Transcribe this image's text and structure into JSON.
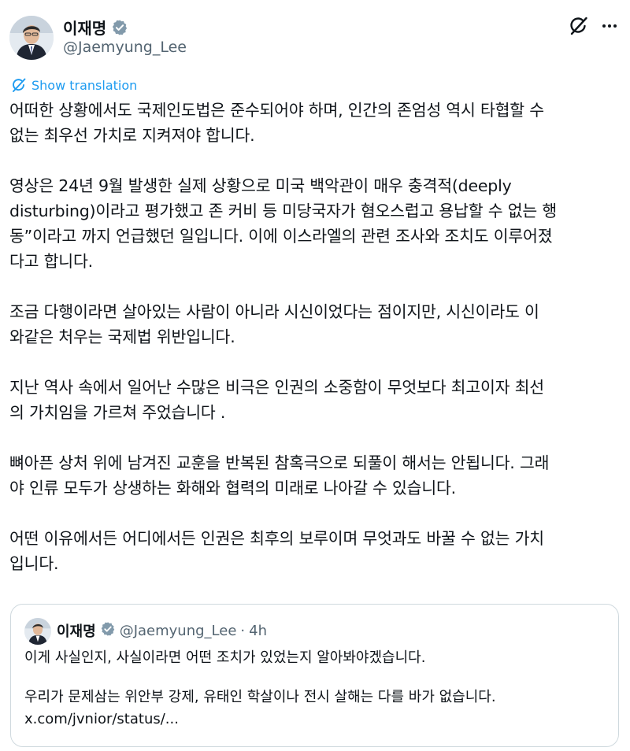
{
  "author": {
    "display_name": "이재명",
    "handle": "@Jaemyung_Lee",
    "verified_icon": "verified-badge-icon"
  },
  "actions": {
    "grok_icon": "grok-icon",
    "more_icon": "more-horizontal-icon"
  },
  "translation": {
    "label": "Show translation",
    "icon": "translate-icon"
  },
  "post": {
    "paragraphs": [
      "어떠한 상황에서도 국제인도법은 준수되어야 하며, 인간의 존엄성 역시 타협할 수\n없는 최우선 가치로 지켜져야 합니다.",
      "영상은 24년 9월 발생한 실제 상황으로 미국 백악관이 매우 충격적(deeply\ndisturbing)이라고 평가했고 존 커비 등 미당국자가 혐오스럽고 용납할 수 없는 행\n동”이라고 까지 언급했던 일입니다. 이에 이스라엘의 관련 조사와 조치도 이루어졌\n다고 합니다.",
      "조금 다행이라면 살아있는 사람이 아니라 시신이었다는 점이지만, 시신이라도 이\n와같은 처우는 국제법 위반입니다.",
      "지난 역사 속에서 일어난 수많은 비극은 인권의 소중함이 무엇보다 최고이자 최선\n의 가치임을 가르쳐 주었습니다 .",
      "뼈아픈 상처 위에 남겨진 교훈을 반복된 참혹극으로 되풀이 해서는 안됩니다. 그래\n야 인류 모두가 상생하는 화해와 협력의 미래로 나아갈 수 있습니다.",
      "어떤 이유에서든 어디에서든 인권은 최후의 보루이며 무엇과도 바꿀 수 없는 가치\n입니다."
    ]
  },
  "quote": {
    "display_name": "이재명",
    "handle": "@Jaemyung_Lee",
    "separator": "·",
    "time": "4h",
    "line1": "이게 사실인지, 사실이라면 어떤 조치가 있었는지 알아봐야겠습니다.",
    "line2": "우리가 문제삼는 위안부 강제, 유태인 학살이나 전시 살해는 다를 바가 없습니다.",
    "link": "x.com/jvnior/status/..."
  },
  "colors": {
    "text": "#0f1419",
    "secondary": "#536471",
    "accent": "#1d9bf0",
    "border": "#cfd9de"
  }
}
